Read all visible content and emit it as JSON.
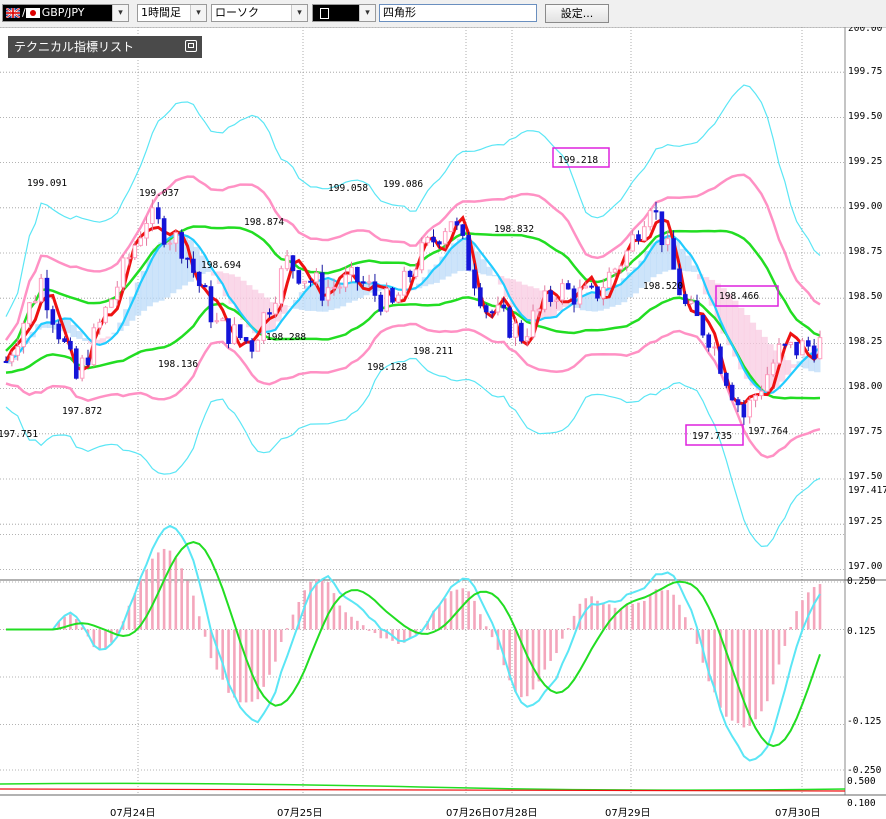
{
  "toolbar": {
    "pair": "GBP/JPY",
    "timeframe": "1時間足",
    "chart_type": "ローソク",
    "draw_tool_icon": "rectangle-icon",
    "shape_name": "四角形",
    "settings_label": "設定..."
  },
  "indicator_list": {
    "title": "テクニカル指標リスト"
  },
  "colors": {
    "candle_up": "#ff9ec0",
    "candle_down": "#1414d8",
    "price_line": "#ee1111",
    "bollinger_outer": "#5be6f5",
    "bollinger_inner": "#ff91c4",
    "sma_short": "#22ccff",
    "sma_long": "#22dd22",
    "cloud_blue": "#b8d8f8",
    "cloud_pink": "#f8c8e0",
    "box": "#dd22dd"
  },
  "price_axis": {
    "labels": [
      "200.00",
      "199.75",
      "199.50",
      "199.25",
      "199.00",
      "198.75",
      "198.50",
      "198.25",
      "198.00",
      "197.75",
      "197.50",
      "197.417",
      "197.25",
      "197.00"
    ]
  },
  "osc_axis": {
    "labels": [
      "0.250",
      "0.125",
      "-0.125",
      "-0.250",
      "0.500",
      "0.100"
    ]
  },
  "dates": [
    "07月24日",
    "07月25日",
    "07月26日",
    "07月28日",
    "07月29日",
    "07月30日"
  ],
  "annotations": {
    "a1": "197.751",
    "a2": "199.091",
    "a3": "197.872",
    "a4": "199.037",
    "a5": "198.136",
    "a6": "198.694",
    "a7": "198.874",
    "a8": "198.288",
    "a9": "199.058",
    "a10": "198.128",
    "a11": "199.086",
    "a12": "198.211",
    "a13": "198.832",
    "a14": "199.218",
    "a15": "198.520",
    "a16": "198.466",
    "a17": "197.735",
    "a18": "197.764"
  },
  "current_price": "197.417"
}
